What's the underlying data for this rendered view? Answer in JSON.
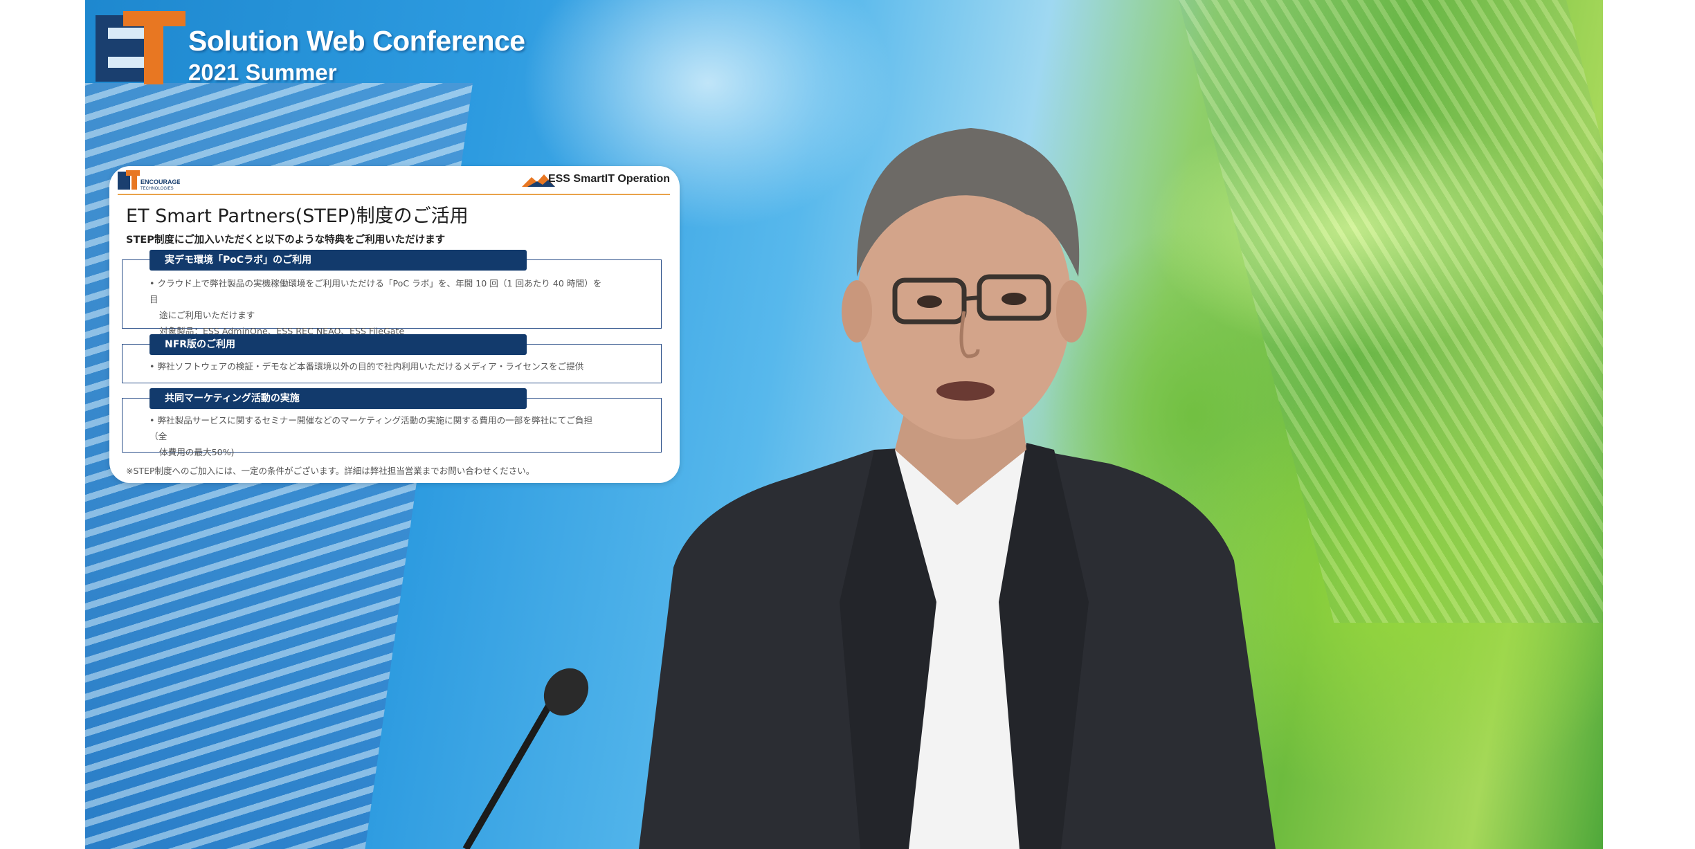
{
  "colors": {
    "accent_orange": "#e87722",
    "brand_blue": "#1a3f6f",
    "slide_header_navy": "#123a6c",
    "slide_rule": "#e9a24a"
  },
  "brand": {
    "logo_letters": "ET",
    "title": "Solution Web Conference",
    "subtitle": "2021 Summer"
  },
  "slide": {
    "left_logo": "ENCOURAGE TECHNOLOGIES",
    "right_logo": "ESS SmartIT Operation",
    "title": "ET Smart Partners(STEP)制度のご活用",
    "subtitle": "STEP制度にご加入いただくと以下のような特典をご利用いただけます",
    "sections": [
      {
        "heading": "実デモ環境「PoCラボ」のご利用",
        "lines": [
          "クラウド上で弊社製品の実機稼働環境をご利用いただける「PoC ラボ」を、年間 10 回（1 回あたり 40 時間）を目",
          "途にご利用いただけます",
          "対象製品：ESS AdminOne、ESS REC NEAO、ESS FileGate"
        ]
      },
      {
        "heading": "NFR版のご利用",
        "lines": [
          "弊社ソフトウェアの検証・デモなど本番環境以外の目的で社内利用いただけるメディア・ライセンスをご提供"
        ]
      },
      {
        "heading": "共同マーケティング活動の実施",
        "lines": [
          "弊社製品サービスに関するセミナー開催などのマーケティング活動の実施に関する費用の一部を弊社にてご負担（全",
          "体費用の最大50%)"
        ]
      }
    ],
    "footnote": "※STEP制度へのご加入には、一定の条件がございます。詳細は弊社担当営業までお問い合わせください。"
  }
}
